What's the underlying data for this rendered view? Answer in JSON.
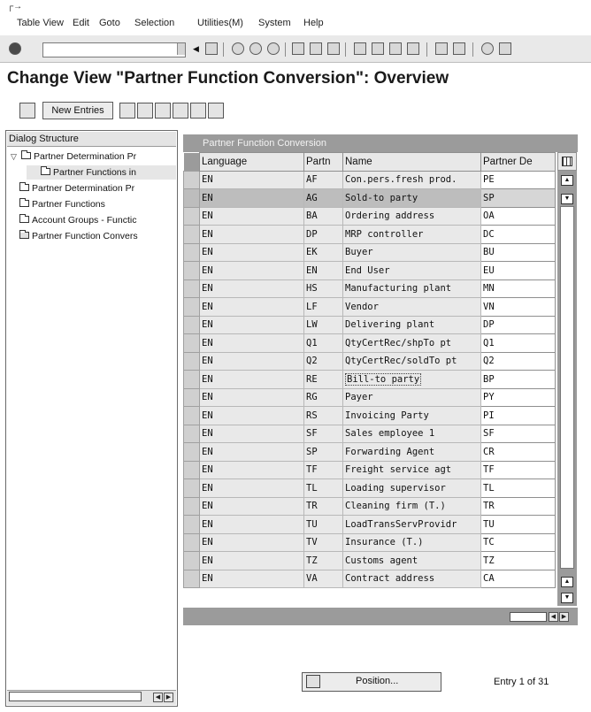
{
  "menu": {
    "items": [
      "Table View",
      "Edit",
      "Goto",
      "Selection",
      "Utilities(M)",
      "System",
      "Help"
    ]
  },
  "title": "Change View \"Partner Function Conversion\": Overview",
  "app_toolbar": {
    "new_entries_label": "New Entries"
  },
  "dialog_structure": {
    "header": "Dialog Structure",
    "items": [
      {
        "label": "Partner Determination Pr",
        "level": 0,
        "expanded": true
      },
      {
        "label": "Partner Functions in",
        "level": 2
      },
      {
        "label": "Partner Determination Pr",
        "level": 0
      },
      {
        "label": "Partner Functions",
        "level": 0
      },
      {
        "label": "Account Groups - Functic",
        "level": 0
      },
      {
        "label": "Partner Function Convers",
        "level": 0,
        "open": true
      }
    ]
  },
  "table": {
    "caption": "Partner Function Conversion",
    "columns": [
      "Language",
      "Partn",
      "Name",
      "Partner De"
    ],
    "rows": [
      {
        "language": "EN",
        "partn": "AF",
        "name": "Con.pers.fresh prod.",
        "partner_de": "PE"
      },
      {
        "language": "EN",
        "partn": "AG",
        "name": "Sold-to party",
        "partner_de": "SP"
      },
      {
        "language": "EN",
        "partn": "BA",
        "name": "Ordering address",
        "partner_de": "OA"
      },
      {
        "language": "EN",
        "partn": "DP",
        "name": "MRP controller",
        "partner_de": "DC"
      },
      {
        "language": "EN",
        "partn": "EK",
        "name": "Buyer",
        "partner_de": "BU"
      },
      {
        "language": "EN",
        "partn": "EN",
        "name": "End User",
        "partner_de": "EU"
      },
      {
        "language": "EN",
        "partn": "HS",
        "name": "Manufacturing plant",
        "partner_de": "MN"
      },
      {
        "language": "EN",
        "partn": "LF",
        "name": "Vendor",
        "partner_de": "VN"
      },
      {
        "language": "EN",
        "partn": "LW",
        "name": "Delivering plant",
        "partner_de": "DP"
      },
      {
        "language": "EN",
        "partn": "Q1",
        "name": "QtyCertRec/shpTo pt",
        "partner_de": "Q1"
      },
      {
        "language": "EN",
        "partn": "Q2",
        "name": "QtyCertRec/soldTo pt",
        "partner_de": "Q2"
      },
      {
        "language": "EN",
        "partn": "RE",
        "name": "Bill-to party",
        "partner_de": "BP"
      },
      {
        "language": "EN",
        "partn": "RG",
        "name": "Payer",
        "partner_de": "PY"
      },
      {
        "language": "EN",
        "partn": "RS",
        "name": "Invoicing Party",
        "partner_de": "PI"
      },
      {
        "language": "EN",
        "partn": "SF",
        "name": "Sales employee 1",
        "partner_de": "SF"
      },
      {
        "language": "EN",
        "partn": "SP",
        "name": "Forwarding Agent",
        "partner_de": "CR"
      },
      {
        "language": "EN",
        "partn": "TF",
        "name": "Freight service agt",
        "partner_de": "TF"
      },
      {
        "language": "EN",
        "partn": "TL",
        "name": "Loading supervisor",
        "partner_de": "TL"
      },
      {
        "language": "EN",
        "partn": "TR",
        "name": "Cleaning firm (T.)",
        "partner_de": "TR"
      },
      {
        "language": "EN",
        "partn": "TU",
        "name": "LoadTransServProvidr",
        "partner_de": "TU"
      },
      {
        "language": "EN",
        "partn": "TV",
        "name": "Insurance (T.)",
        "partner_de": "TC"
      },
      {
        "language": "EN",
        "partn": "TZ",
        "name": "Customs agent",
        "partner_de": "TZ"
      },
      {
        "language": "EN",
        "partn": "VA",
        "name": "Contract address",
        "partner_de": "CA"
      }
    ]
  },
  "footer": {
    "position_label": "Position...",
    "entry_text": "Entry 1 of 31"
  },
  "selected_row_index": 1,
  "focused_row_index": 11
}
